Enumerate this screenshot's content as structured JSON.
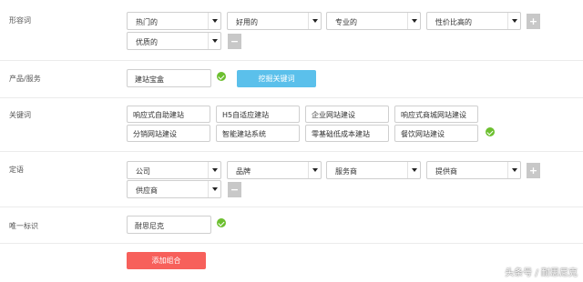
{
  "adjectives": {
    "label": "形容词",
    "options": [
      "热门的",
      "好用的",
      "专业的",
      "性价比高的",
      "优质的"
    ],
    "add_symbol": "+",
    "remove_symbol": "−"
  },
  "product": {
    "label": "产品/服务",
    "value": "建站宝盒",
    "mine_button": "挖掘关键词"
  },
  "keywords": {
    "label": "关键词",
    "items": [
      "响应式自助建站",
      "H5自适应建站",
      "企业网站建设",
      "响应式商城网站建设",
      "分销网站建设",
      "智能建站系统",
      "零基础低成本建站",
      "餐饮网站建设"
    ]
  },
  "modifiers": {
    "label": "定语",
    "options": [
      "公司",
      "品牌",
      "服务商",
      "提供商",
      "供应商"
    ],
    "add_symbol": "+",
    "remove_symbol": "−"
  },
  "unique_id": {
    "label": "唯一标识",
    "value": "耐思尼克"
  },
  "add_group_button": "添加组合",
  "watermark": "头条号 / 耐思尼克",
  "colors": {
    "check": "#6cbf2f",
    "blue_button": "#5bc0eb",
    "red_button": "#f7605b"
  }
}
